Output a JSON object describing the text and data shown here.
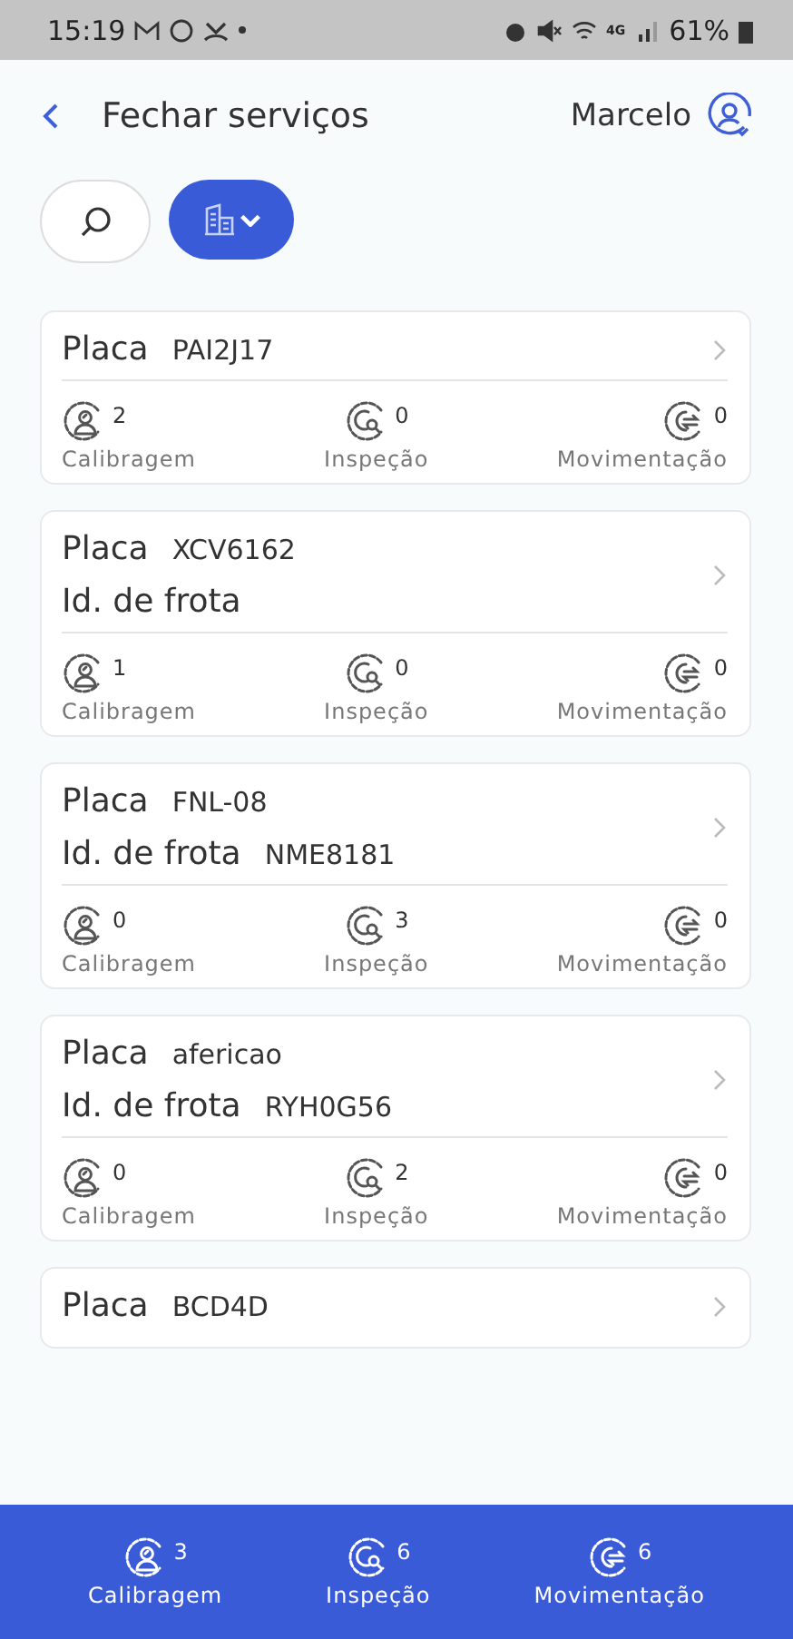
{
  "status_bar": {
    "time": "15:19",
    "network": "4G",
    "battery": "61%"
  },
  "header": {
    "title": "Fechar serviços",
    "user": "Marcelo"
  },
  "cards": [
    {
      "plate_label": "Placa",
      "plate": "PAI2J17",
      "stats": [
        {
          "kind": "calibragem",
          "count": "2",
          "label": "Calibragem"
        },
        {
          "kind": "inspecao",
          "count": "0",
          "label": "Inspeção"
        },
        {
          "kind": "movimentacao",
          "count": "0",
          "label": "Movimentação"
        }
      ]
    },
    {
      "plate_label": "Placa",
      "plate": "XCV6162",
      "fleet_label": "Id. de frota",
      "stats": [
        {
          "kind": "calibragem",
          "count": "1",
          "label": "Calibragem"
        },
        {
          "kind": "inspecao",
          "count": "0",
          "label": "Inspeção"
        },
        {
          "kind": "movimentacao",
          "count": "0",
          "label": "Movimentação"
        }
      ]
    },
    {
      "plate_label": "Placa",
      "plate": "FNL-08",
      "fleet_label": "Id. de frota",
      "fleet": "NME8181",
      "stats": [
        {
          "kind": "calibragem",
          "count": "0",
          "label": "Calibragem"
        },
        {
          "kind": "inspecao",
          "count": "3",
          "label": "Inspeção"
        },
        {
          "kind": "movimentacao",
          "count": "0",
          "label": "Movimentação"
        }
      ]
    },
    {
      "plate_label": "Placa",
      "plate": "afericao",
      "fleet_label": "Id. de frota",
      "fleet": "RYH0G56",
      "stats": [
        {
          "kind": "calibragem",
          "count": "0",
          "label": "Calibragem"
        },
        {
          "kind": "inspecao",
          "count": "2",
          "label": "Inspeção"
        },
        {
          "kind": "movimentacao",
          "count": "0",
          "label": "Movimentação"
        }
      ]
    },
    {
      "plate_label": "Placa",
      "plate": "BCD4D"
    }
  ],
  "totals": [
    {
      "kind": "calibragem",
      "count": "3",
      "label": "Calibragem"
    },
    {
      "kind": "inspecao",
      "count": "6",
      "label": "Inspeção"
    },
    {
      "kind": "movimentacao",
      "count": "6",
      "label": "Movimentação"
    }
  ]
}
